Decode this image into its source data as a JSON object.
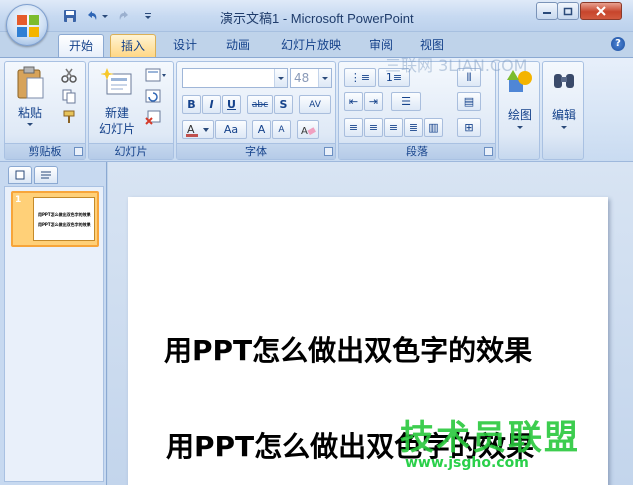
{
  "title": "演示文稿1 - Microsoft PowerPoint",
  "tabs": [
    "开始",
    "插入",
    "设计",
    "动画",
    "幻灯片放映",
    "审阅",
    "视图"
  ],
  "groups": {
    "clipboard": {
      "label": "剪贴板",
      "paste": "粘贴"
    },
    "slides": {
      "label": "幻灯片",
      "new_slide_1": "新建",
      "new_slide_2": "幻灯片"
    },
    "font": {
      "label": "字体",
      "size": "48"
    },
    "paragraph": {
      "label": "段落"
    },
    "drawing": {
      "label": "绘图"
    },
    "editing": {
      "label": "编辑"
    }
  },
  "slide": {
    "number": "1",
    "title1": "用PPT怎么做出双色字的效果",
    "title2": "用PPT怎么做出双色字的效果"
  },
  "watermarks": {
    "top": "三联网 3LIAN.COM",
    "logo": "技术员联盟",
    "url": "www.jsgho.com"
  },
  "colors": {
    "accent": "#f7a53a",
    "ribbon": "#d6e4f5",
    "watermark": "#2ad04a"
  }
}
